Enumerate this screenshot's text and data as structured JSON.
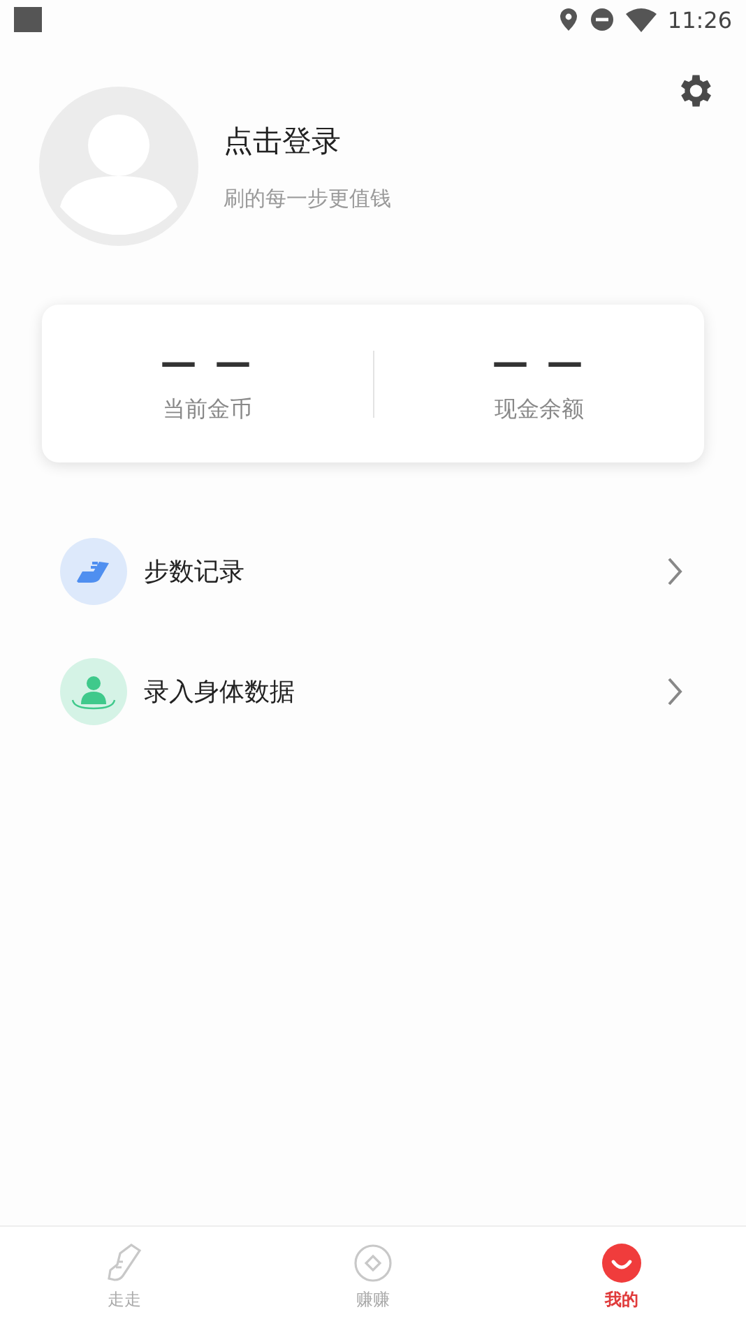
{
  "status_bar": {
    "time": "11:26"
  },
  "profile": {
    "title": "点击登录",
    "subtitle": "刷的每一步更值钱"
  },
  "stats": [
    {
      "value": "— —",
      "label": "当前金币"
    },
    {
      "value": "— —",
      "label": "现金余额"
    }
  ],
  "menu": [
    {
      "kind": "steps",
      "label": "步数记录"
    },
    {
      "kind": "body",
      "label": "录入身体数据"
    }
  ],
  "tabs": [
    {
      "kind": "walk",
      "label": "走走",
      "selected": false
    },
    {
      "kind": "earn",
      "label": "赚赚",
      "selected": false
    },
    {
      "kind": "me",
      "label": "我的",
      "selected": true
    }
  ]
}
